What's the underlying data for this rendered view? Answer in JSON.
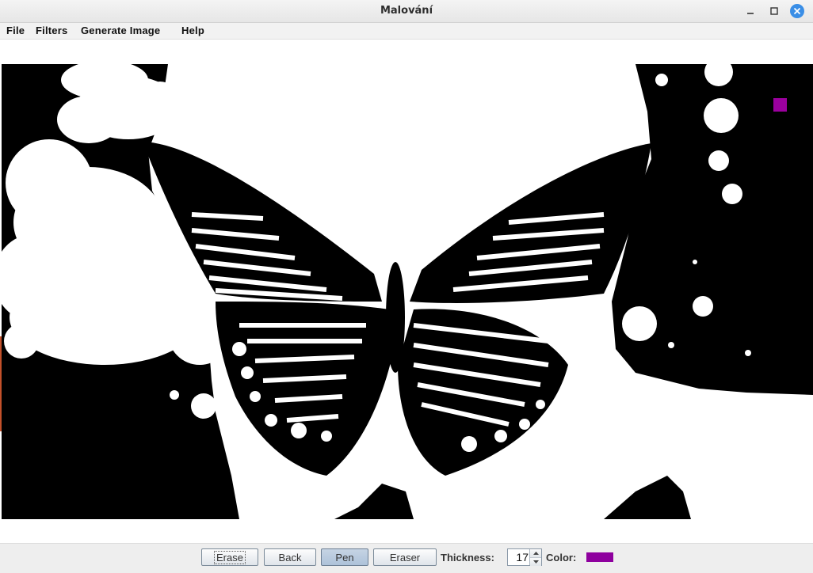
{
  "window": {
    "title": "Malování"
  },
  "menu": {
    "items": [
      "File",
      "Filters",
      "Generate Image",
      "Help"
    ]
  },
  "toolbar": {
    "erase_label": "Erase",
    "back_label": "Back",
    "pen_label": "Pen",
    "eraser_label": "Eraser",
    "thickness_label": "Thickness:",
    "thickness_value": "17",
    "color_label": "Color:",
    "color_value": "#8e009e"
  },
  "icons": {
    "minimize": "minimize-icon",
    "maximize": "maximize-icon",
    "close": "close-icon",
    "spinner_up": "chevron-up-icon",
    "spinner_down": "chevron-down-icon"
  },
  "colors": {
    "close_button": "#3a8ee6",
    "pen_marker": "#9b009e"
  }
}
